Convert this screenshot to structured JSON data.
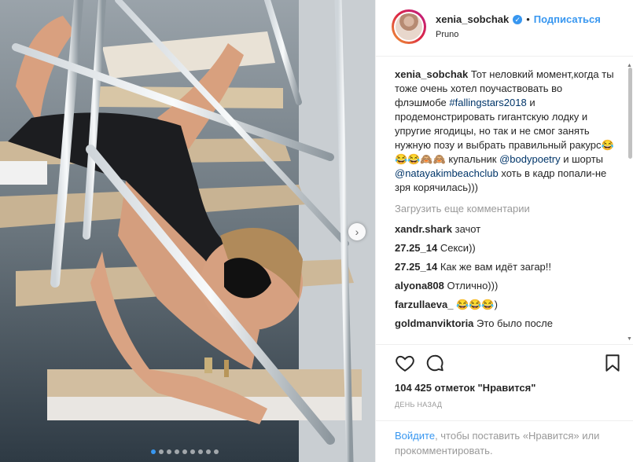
{
  "post": {
    "username": "xenia_sobchak",
    "separator": "•",
    "follow_label": "Подписаться",
    "location": "Pruno",
    "verified_glyph": "✓",
    "caption": {
      "user": "xenia_sobchak",
      "text_1": "Тот неловкий момент,когда ты тоже очень хотел поучаствовать во флэшмобе",
      "hashtag": "#fallingstars2018",
      "text_2": "и продемонстрировать гигантскую лодку и упругие ягодицы, но так и не смог занять нужную позу и выбрать правильный ракурс😂😂😂🙈🙈",
      "text_3": "купальник",
      "mention_1": "@bodypoetry",
      "text_4": "и шорты",
      "mention_2": "@natayakimbeachclub",
      "text_5": "хоть в кадр попали-не зря корячилась)))"
    },
    "load_more": "Загрузить еще комментарии",
    "comments": [
      {
        "user": "xandr.shark",
        "text": "зачот"
      },
      {
        "user": "27.25_14",
        "text": "Секси))"
      },
      {
        "user": "27.25_14",
        "text": "Как же вам идёт загар!!"
      },
      {
        "user": "alyona808",
        "text": "Отлично)))"
      },
      {
        "user": "farzullaeva_",
        "text": "😂😂😂)"
      },
      {
        "user": "goldmanviktoria",
        "text": "Это было после"
      }
    ],
    "likes": "104 425 отметок \"Нравится\"",
    "date": "ДЕНЬ НАЗАД",
    "footer": {
      "login": "Войдите",
      "rest": ", чтобы поставить «Нравится» или прокомментировать."
    },
    "carousel": {
      "total_dots": 9,
      "active_index": 0
    }
  },
  "colors": {
    "accent": "#3897f0",
    "link": "#003569",
    "muted": "#999999"
  }
}
